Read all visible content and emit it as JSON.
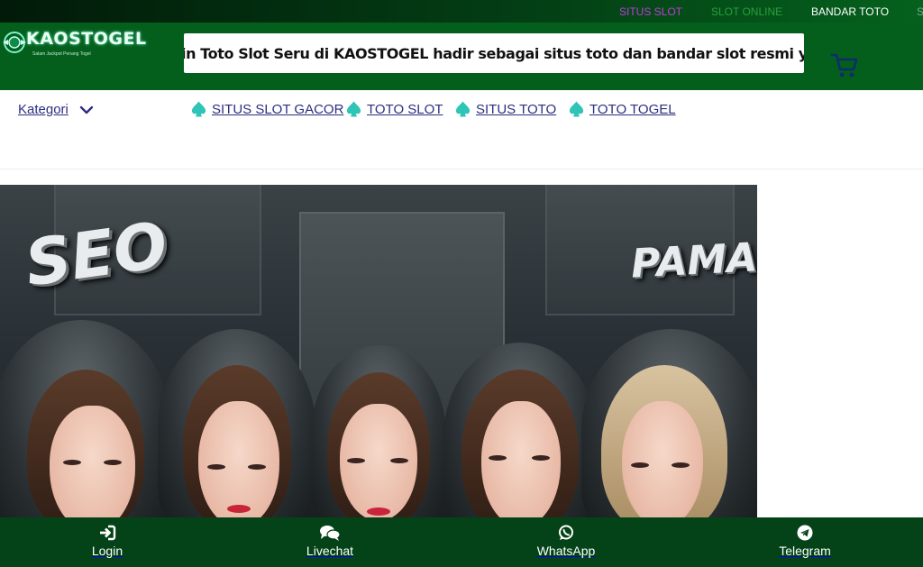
{
  "topbar": {
    "links": [
      {
        "label": "SITUS SLOT",
        "color": "#c13bd8"
      },
      {
        "label": "SLOT ONLINE",
        "color": "#2a9f3c"
      },
      {
        "label": "BANDAR TOTO",
        "color": "#ffffff"
      },
      {
        "label": "S",
        "color": "#7aa88a"
      }
    ]
  },
  "header": {
    "logo_text": "KAOSTOGEL",
    "logo_tagline": "Salam Jackpot Penang Togel",
    "marquee_text": "in Toto Slot Seru di KAOSTOGEL hadir sebagai situs toto dan bandar slot resmi yang menyediakan",
    "cart_icon": "cart-icon"
  },
  "nav": {
    "kategori_label": "Kategori",
    "items": [
      {
        "label": "SITUS SLOT GACOR",
        "icon": "spade-icon"
      },
      {
        "label": "TOTO SLOT",
        "icon": "spade-icon"
      },
      {
        "label": "SITUS TOTO",
        "icon": "spade-icon"
      },
      {
        "label": "TOTO TOGEL",
        "icon": "spade-icon"
      }
    ]
  },
  "banner": {
    "text_left": "SEO",
    "text_right": "PAMAN"
  },
  "bottom_bar": {
    "items": [
      {
        "label": "Login",
        "icon": "login-icon"
      },
      {
        "label": "Livechat",
        "icon": "chat-icon"
      },
      {
        "label": "WhatsApp",
        "icon": "whatsapp-icon"
      },
      {
        "label": "Telegram",
        "icon": "telegram-icon"
      }
    ]
  },
  "colors": {
    "header_green": "#045f1d",
    "bottom_green": "#034317",
    "nav_text": "#2b2f7f",
    "spade": "#2ec4b6"
  }
}
